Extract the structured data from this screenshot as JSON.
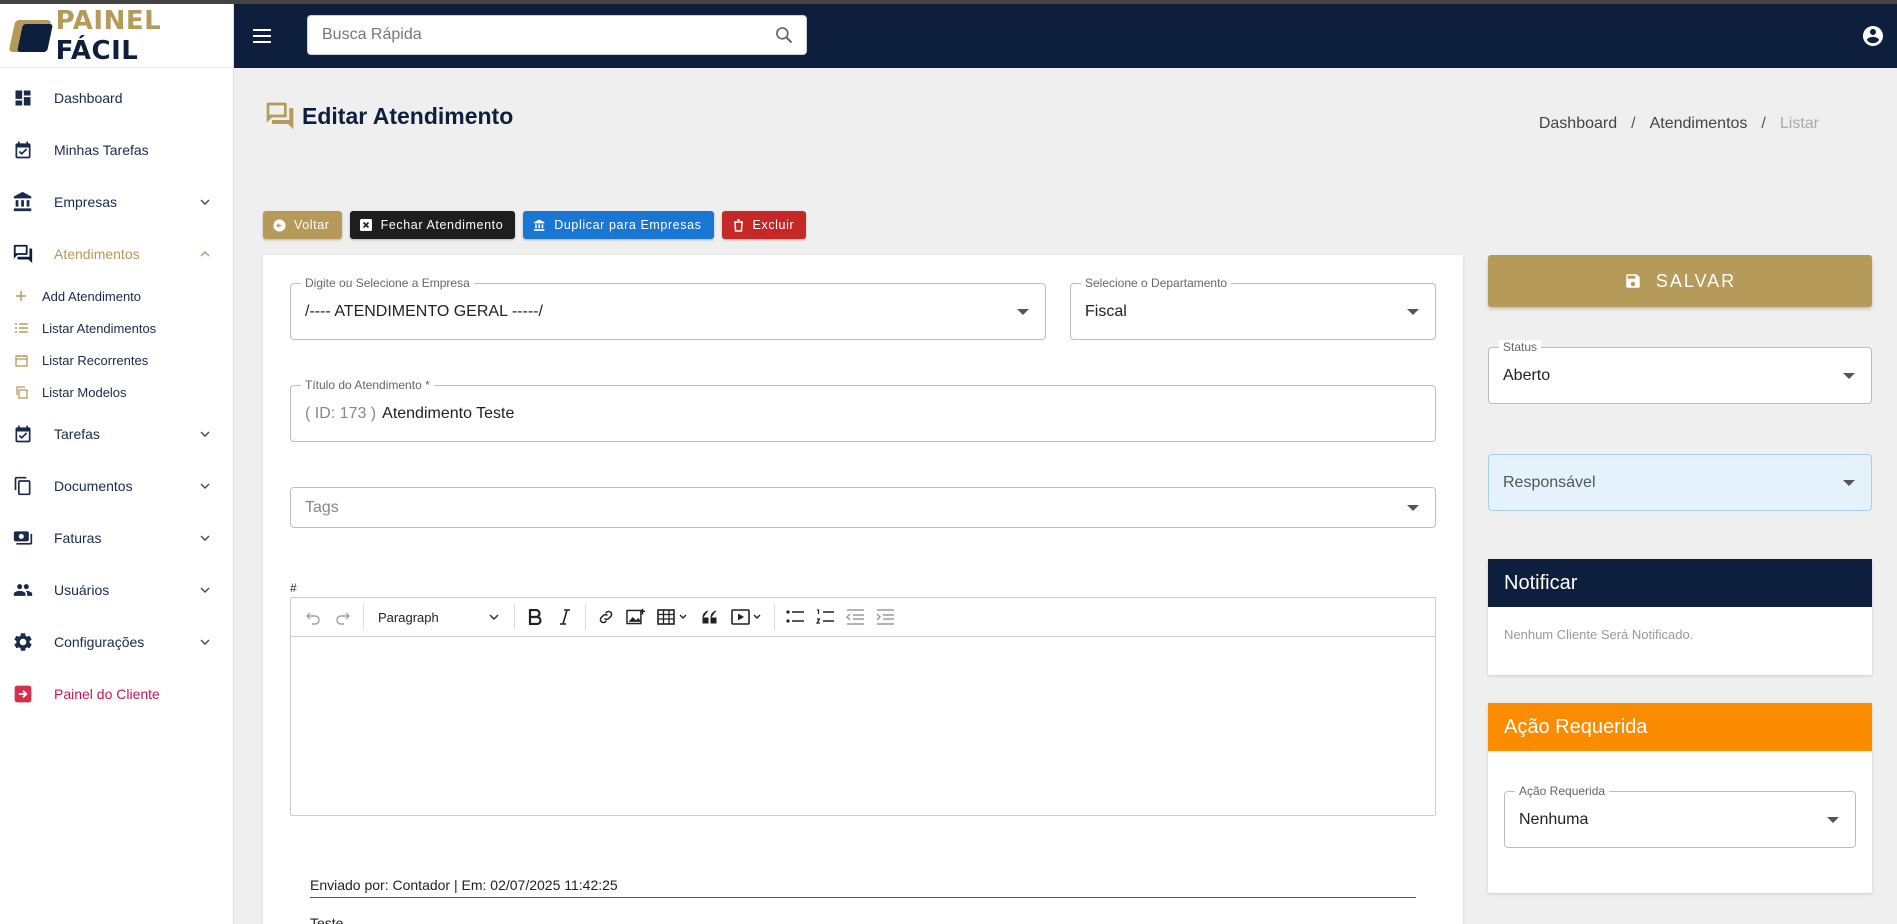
{
  "brand": {
    "part1": "PAINEL",
    "part2": "FÁCIL"
  },
  "sidebar": {
    "items": [
      {
        "label": "Dashboard"
      },
      {
        "label": "Minhas Tarefas"
      },
      {
        "label": "Empresas"
      },
      {
        "label": "Atendimentos"
      },
      {
        "label": "Tarefas"
      },
      {
        "label": "Documentos"
      },
      {
        "label": "Faturas"
      },
      {
        "label": "Usuários"
      },
      {
        "label": "Configurações"
      },
      {
        "label": "Painel do Cliente"
      }
    ],
    "sub": [
      {
        "label": "Add Atendimento"
      },
      {
        "label": "Listar Atendimentos"
      },
      {
        "label": "Listar Recorrentes"
      },
      {
        "label": "Listar Modelos"
      }
    ]
  },
  "header": {
    "search_placeholder": "Busca Rápida"
  },
  "page": {
    "title": "Editar Atendimento",
    "breadcrumb": [
      "Dashboard",
      "Atendimentos",
      "Listar"
    ],
    "sep": "/"
  },
  "actions": {
    "back": "Voltar",
    "close": "Fechar Atendimento",
    "duplicate": "Duplicar para Empresas",
    "delete": "Excluir"
  },
  "form": {
    "empresa_label": "Digite ou Selecione a Empresa",
    "empresa_value": "/---- ATENDIMENTO GERAL -----/",
    "departamento_label": "Selecione o Departamento",
    "departamento_value": "Fiscal",
    "titulo_label": "Título do Atendimento *",
    "titulo_prefix": "( ID: 173 )",
    "titulo_value": "Atendimento Teste",
    "tags_placeholder": "Tags",
    "hash": "#",
    "paragraph": "Paragraph",
    "meta": "Enviado por: Contador | Em: 02/07/2025 11:42:25",
    "more": "Teste"
  },
  "right": {
    "save": "SALVAR",
    "status_label": "Status",
    "status_value": "Aberto",
    "responsavel_placeholder": "Responsável",
    "notificar_title": "Notificar",
    "notificar_text": "Nenhum Cliente Será Notificado.",
    "acao_title": "Ação Requerida",
    "acao_label": "Ação Requerida",
    "acao_value": "Nenhuma"
  },
  "colors": {
    "navy": "#0d1f3c",
    "gold": "#b59a5a",
    "blue": "#1976d2",
    "red": "#c62828",
    "orange": "#fb8c00"
  }
}
